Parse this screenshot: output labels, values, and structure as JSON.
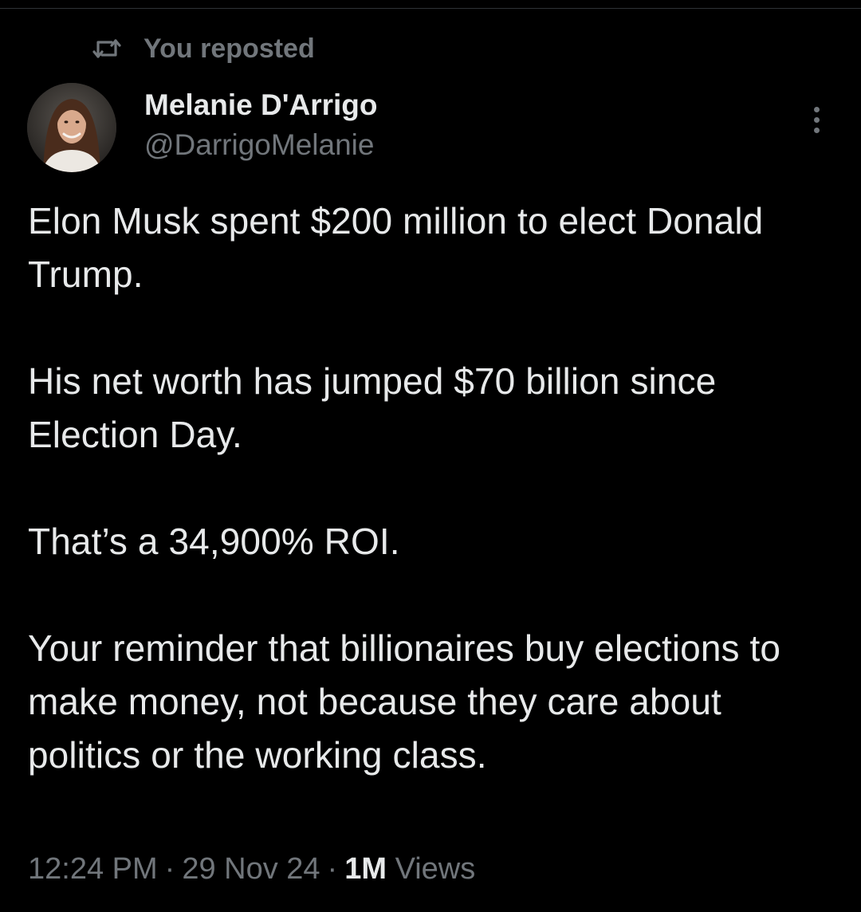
{
  "repost": {
    "label": "You reposted",
    "icon": "repost-icon"
  },
  "author": {
    "name": "Melanie D'Arrigo",
    "handle": "@DarrigoMelanie",
    "avatar_icon": "avatar-photo"
  },
  "tweet": {
    "paragraphs": [
      "Elon Musk spent $200 million to elect Donald Trump.",
      "His net worth has jumped $70 billion since Election Day.",
      "That’s a 34,900% ROI.",
      "Your reminder that billionaires buy elections to make money, not because they care about politics or the working class."
    ]
  },
  "meta": {
    "time": "12:24 PM",
    "separator": "·",
    "date": "29 Nov 24",
    "views_count": "1M",
    "views_label": "Views"
  },
  "colors": {
    "background": "#000000",
    "primary_text": "#e7e9ea",
    "secondary_text": "#71767b"
  }
}
